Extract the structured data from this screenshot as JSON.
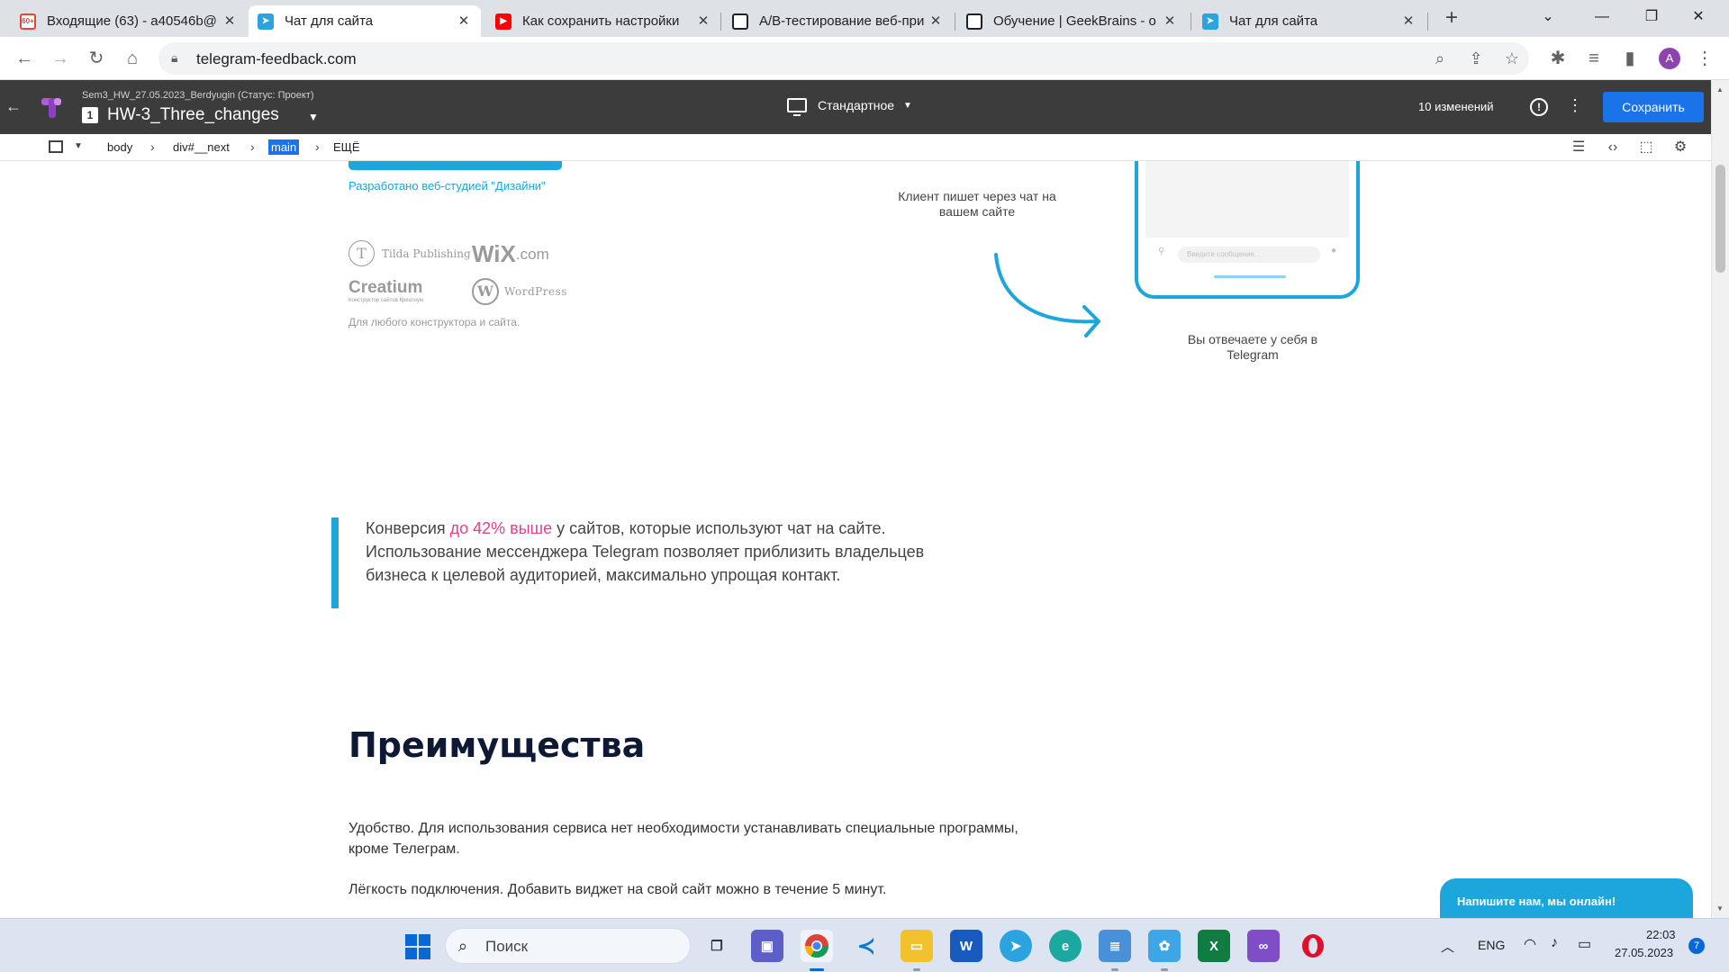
{
  "browser": {
    "tabs": [
      {
        "title": "Входящие (63) - a40546b@",
        "favicon": "gmail-icon",
        "badge": "60+",
        "active": false
      },
      {
        "title": "Чат для сайта",
        "favicon": "telegram-icon",
        "active": true
      },
      {
        "title": "Как сохранить настройки",
        "favicon": "youtube-icon",
        "active": false
      },
      {
        "title": "A/B-тестирование веб-при",
        "favicon": "chatgpt-icon",
        "active": false
      },
      {
        "title": "Обучение | GeekBrains - о",
        "favicon": "chatgpt-icon",
        "active": false
      },
      {
        "title": "Чат для сайта",
        "favicon": "telegram-icon",
        "active": false
      }
    ],
    "url": "telegram-feedback.com",
    "profile_initial": "A"
  },
  "editor": {
    "project": "Sem3_HW_27.05.2023_Berdyugin (Статус: Проект)",
    "page_number": "1",
    "page_name": "HW-3_Three_changes",
    "device_mode": "Стандартное",
    "changes": "10 изменений",
    "save_label": "Сохранить"
  },
  "breadcrumbs": {
    "items": [
      "body",
      "div#__next",
      "main",
      "ЕЩЁ"
    ],
    "selected": "main"
  },
  "page": {
    "developer_credit": "Разработано веб-студией \"Дизайни\"",
    "logos": {
      "tilda": "Tilda Publishing",
      "wix": "WiX",
      "wix_suffix": ".com",
      "creatium": "Creatium",
      "creatium_sub": "Конструктор сайтов Креатиум",
      "wordpress": "WordPress"
    },
    "any_builder": "Для любого конструктора и сайта.",
    "client_writes": "Клиент пишет через чат на вашем сайте",
    "you_reply": "Вы отвечаете у себя в Telegram",
    "phone_input_placeholder": "Введите сообщение...",
    "quote_prefix": "Конверсия ",
    "quote_highlight": "до 42% выше",
    "quote_rest": " у сайтов, которые используют чат на сайте. Использование мессенджера Telegram позволяет приблизить владельцев бизнеса к целевой аудиторией, максимально упрощая контакт.",
    "advantages_title": "Преимущества",
    "advantage_1": "Удобство. Для использования сервиса нет необходимости устанавливать специальные программы, кроме Телеграм.",
    "advantage_2": "Лёгкость подключения. Добавить виджет на свой сайт можно в течение 5 минут.",
    "chat_widget": "Напишите нам, мы онлайн!",
    "accent_color": "#1ca6db",
    "highlight_color": "#e83e8c"
  },
  "taskbar": {
    "search_placeholder": "Поиск",
    "lang": "ENG",
    "time": "22:03",
    "date": "27.05.2023",
    "notifications": "7",
    "apps": [
      "task-view",
      "teams-chat",
      "chrome",
      "vscode",
      "file-explorer",
      "word",
      "telegram",
      "edge",
      "notepad",
      "photos",
      "excel",
      "visual-studio",
      "opera"
    ]
  }
}
